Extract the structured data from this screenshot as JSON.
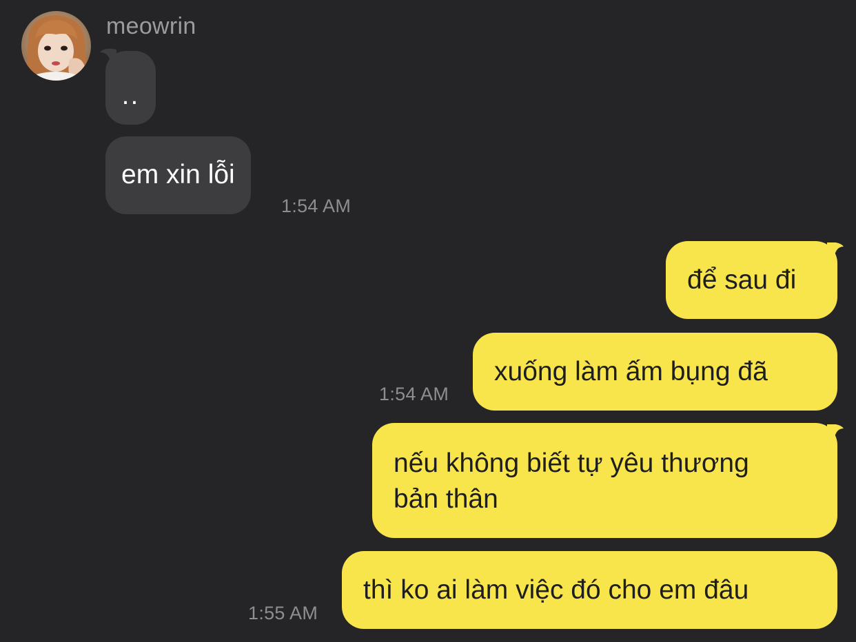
{
  "chat": {
    "sender_name": "meowrin",
    "avatar": "profile-photo"
  },
  "messages": [
    {
      "direction": "incoming",
      "text": ".."
    },
    {
      "direction": "incoming",
      "text": "em xin lỗi",
      "time": "1:54 AM"
    },
    {
      "direction": "outgoing",
      "text": "để sau đi"
    },
    {
      "direction": "outgoing",
      "text": "xuống làm ấm bụng đã",
      "time": "1:54 AM"
    },
    {
      "direction": "outgoing",
      "text_line1": "nếu không biết tự yêu thương",
      "text_line2": "bản thân"
    },
    {
      "direction": "outgoing",
      "text": "thì ko ai làm việc đó cho em đâu",
      "time": "1:55 AM"
    }
  ],
  "colors": {
    "background": "#252528",
    "incoming_bubble": "#3d3d40",
    "outgoing_bubble": "#f8e54b",
    "timestamp": "#8e8e90"
  }
}
